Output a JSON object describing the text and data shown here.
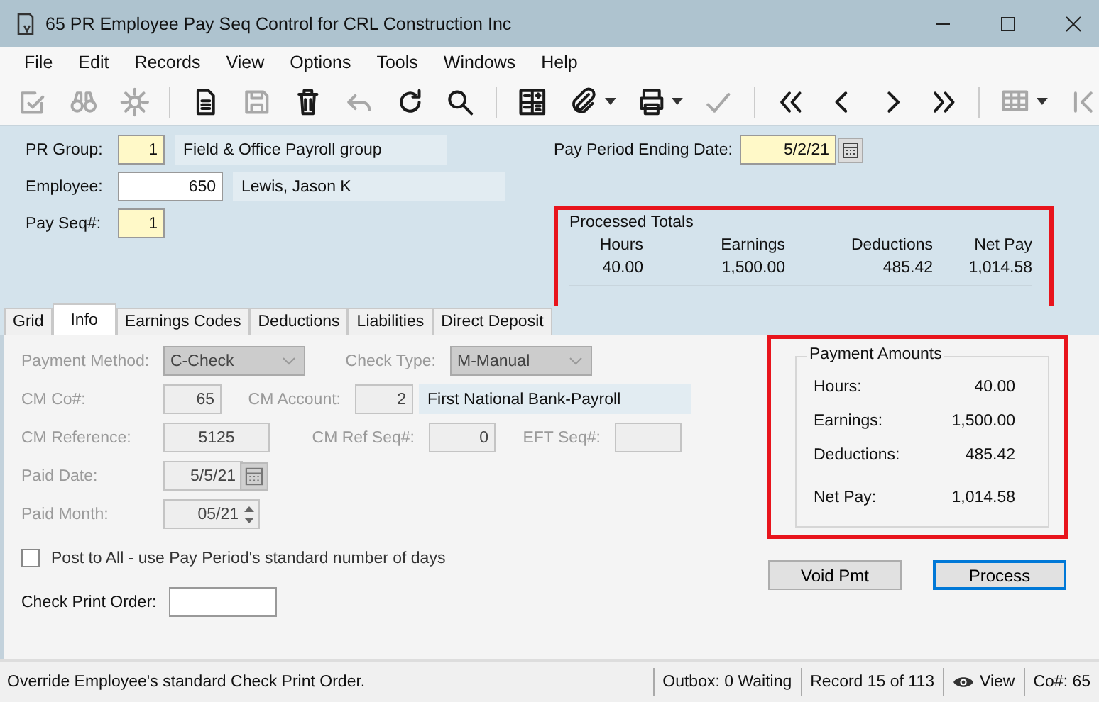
{
  "window": {
    "title": "65 PR Employee Pay Seq Control for CRL Construction Inc"
  },
  "menu": [
    "File",
    "Edit",
    "Records",
    "View",
    "Options",
    "Tools",
    "Windows",
    "Help"
  ],
  "toolbar": [
    {
      "disabled": true
    },
    {
      "disabled": true
    },
    {
      "disabled": true
    },
    {
      "disabled": false
    },
    {
      "disabled": true
    },
    {
      "disabled": false
    },
    {
      "disabled": true
    },
    {
      "disabled": false
    },
    {
      "disabled": false
    },
    {
      "disabled": false
    },
    {
      "disabled": false
    },
    {
      "disabled": false
    },
    {
      "disabled": true
    },
    {
      "disabled": false
    },
    {
      "disabled": false
    },
    {
      "disabled": false
    },
    {
      "disabled": false
    },
    {
      "disabled": true
    },
    {
      "disabled": true
    }
  ],
  "header": {
    "pr_group": {
      "label": "PR Group:",
      "value": "1",
      "description": "Field & Office Payroll group"
    },
    "employee": {
      "label": "Employee:",
      "value": "650",
      "description": "Lewis, Jason K"
    },
    "pay_seq": {
      "label": "Pay Seq#:",
      "value": "1"
    },
    "pay_period_ending": {
      "label": "Pay Period Ending Date:",
      "value": "5/2/21"
    }
  },
  "processed_totals": {
    "title": "Processed Totals",
    "columns": [
      "Hours",
      "Earnings",
      "Deductions",
      "Net Pay"
    ],
    "values": [
      "40.00",
      "1,500.00",
      "485.42",
      "1,014.58"
    ]
  },
  "tabs": [
    {
      "label": "Grid",
      "selected": false
    },
    {
      "label": "Info",
      "selected": true
    },
    {
      "label": "Earnings Codes",
      "selected": false
    },
    {
      "label": "Deductions",
      "selected": false
    },
    {
      "label": "Liabilities",
      "selected": false
    },
    {
      "label": "Direct Deposit",
      "selected": false
    }
  ],
  "info": {
    "payment_method": {
      "label": "Payment Method:",
      "value": "C-Check",
      "disabled": true
    },
    "check_type": {
      "label": "Check Type:",
      "value": "M-Manual",
      "disabled": true
    },
    "cm_co": {
      "label": "CM Co#:",
      "value": "65",
      "disabled": true
    },
    "cm_account": {
      "label": "CM Account:",
      "value": "2",
      "description": "First National Bank-Payroll",
      "disabled": true
    },
    "cm_reference": {
      "label": "CM Reference:",
      "value": "5125",
      "disabled": true
    },
    "cm_ref_seq": {
      "label": "CM Ref Seq#:",
      "value": "0",
      "disabled": true
    },
    "eft_seq": {
      "label": "EFT Seq#:",
      "disabled": true
    },
    "paid_date": {
      "label": "Paid Date:",
      "value": "5/5/21",
      "disabled": true
    },
    "paid_month": {
      "label": "Paid Month:",
      "value": "05/21",
      "disabled": true
    },
    "post_to_all": {
      "label": "Post to All - use Pay Period's standard number of days",
      "checked": false
    },
    "check_print_order": {
      "label": "Check Print Order:",
      "disabled": false
    }
  },
  "payment_amounts": {
    "title": "Payment Amounts",
    "rows": [
      {
        "label": "Hours:",
        "value": "40.00"
      },
      {
        "label": "Earnings:",
        "value": "1,500.00"
      },
      {
        "label": "Deductions:",
        "value": "485.42"
      },
      {
        "label": "Net Pay:",
        "value": "1,014.58"
      }
    ]
  },
  "buttons": [
    {
      "label": "Void Pmt",
      "default": false
    },
    {
      "label": "Process",
      "default": true
    }
  ],
  "status_bar": {
    "message": "Override Employee's standard Check Print Order.",
    "outbox": "Outbox: 0 Waiting",
    "record": "Record 15 of 113",
    "view": "View",
    "company": "Co#: 65"
  }
}
